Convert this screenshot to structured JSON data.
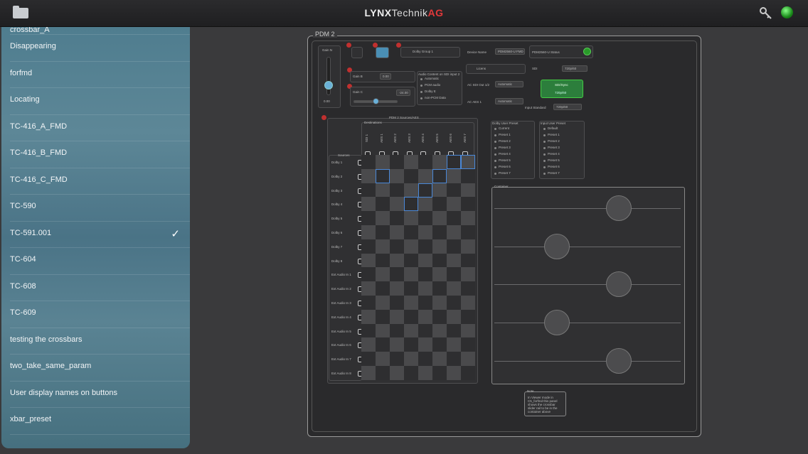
{
  "header": {
    "brand_bold": "LYNX",
    "brand_regular": "Technik",
    "brand_red": "AG"
  },
  "icons": {
    "folder": "folder-icon",
    "key": "key-icon",
    "status": "status-led"
  },
  "colors": {
    "accent_red": "#e0383a",
    "led_green": "#22aa22",
    "sidebar": "#52808f"
  },
  "sidebar": {
    "items": [
      {
        "label": "crossbar_A"
      },
      {
        "label": "Disappearing"
      },
      {
        "label": "forfmd"
      },
      {
        "label": "Locating"
      },
      {
        "label": "TC-416_A_FMD"
      },
      {
        "label": "TC-416_B_FMD"
      },
      {
        "label": "TC-416_C_FMD"
      },
      {
        "label": "TC-590"
      },
      {
        "label": "TC-591.001",
        "selected": true
      },
      {
        "label": "TC-604"
      },
      {
        "label": "TC-608"
      },
      {
        "label": "TC-609"
      },
      {
        "label": "testing the crossbars"
      },
      {
        "label": "two_take_same_param"
      },
      {
        "label": "User display names on buttons"
      },
      {
        "label": "xbar_preset"
      }
    ]
  },
  "panel": {
    "title": "PDM 2",
    "gain_label": "Gain N",
    "gain_value": "0.00",
    "gain_b_label": "Gain B",
    "gain_b_value": "0.00",
    "gain_c_label": "Gain C",
    "gain_c_value": "-24.00",
    "audio_content_label": "Audio Content on SDI input 2",
    "audio_options": [
      "Automatic",
      "PCM audio",
      "Dolby E",
      "non-PCM Data"
    ],
    "device_name_label": "Device Name",
    "device_name_value": "PDM2560-U FMD",
    "status_label": "PDM2560-U Status",
    "license_label": "Licens",
    "sdi_label": "SDI",
    "sdi_value": "720p/60",
    "ac_sdi_label": "AC SDI Out 1/2",
    "ac_sdi_value": "Automatic",
    "ac_aes_label": "AC AES 1",
    "ac_aes_value": "Automatic",
    "signal_button": "SDI/Sync",
    "signal_sub": "720p/60",
    "input_standard_label": "Input Standard",
    "input_standard_value": "720p/60",
    "dolby_group_label": "Dolby Group 1",
    "crossbar_title": "PDM 2 Sources/AES",
    "destinations_label": "Destinations",
    "sources_label": "Sources",
    "destinations": [
      "SDI 1",
      "AES 1",
      "AES 2",
      "AES 3",
      "AES 4",
      "AES 5",
      "AES 6",
      "AES 7"
    ],
    "sources": [
      "Dolby 1",
      "Dolby 2",
      "Dolby 3",
      "Dolby 4",
      "Dolby 5",
      "Dolby 6",
      "Dolby 7",
      "Dolby 8",
      "Ext Audio In 1",
      "Ext Audio In 2",
      "Ext Audio In 3",
      "Ext Audio In 4",
      "Ext Audio In 5",
      "Ext Audio In 6",
      "Ext Audio In 7",
      "Ext Audio In 8"
    ],
    "dolby_user_preset_label": "Dolby User Preset",
    "dolby_presets": [
      "Current",
      "Preset 1",
      "Preset 2",
      "Preset 3",
      "Preset 4",
      "Preset 5",
      "Preset 6",
      "Preset 7"
    ],
    "input_user_preset_label": "Input User Preset",
    "input_presets": [
      "Default",
      "Preset 1",
      "Preset 2",
      "Preset 3",
      "Preset 4",
      "Preset 5",
      "Preset 6",
      "Preset 7"
    ],
    "container_label": "Container",
    "note_label": "Note",
    "note_text": "In Viewer mode in C5_forfmd this panel shows the crossbar slider rail to be in the container above"
  }
}
